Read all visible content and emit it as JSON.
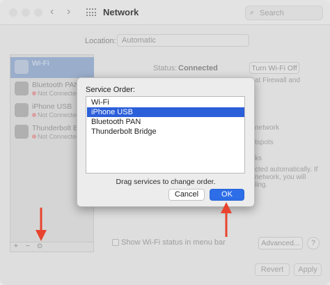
{
  "window": {
    "title": "Network",
    "search_placeholder": "Search"
  },
  "background": {
    "location_label": "Location:",
    "location_value": "Automatic",
    "status_label": "Status:",
    "status_value": "Connected",
    "turn_off_label": "Turn Wi-Fi Off",
    "fragments": [
      "at Firewall and",
      "network",
      "tspots",
      "ks",
      "cted automatically. If",
      "network, you will",
      "ling."
    ],
    "wifi_status_label": "Show Wi-Fi status in menu bar",
    "advanced_label": "Advanced...",
    "help_label": "?",
    "revert_label": "Revert",
    "apply_label": "Apply"
  },
  "sidebar": {
    "items": [
      {
        "name": "Wi-Fi",
        "status": ""
      },
      {
        "name": "Bluetooth PAN",
        "status": "Not Connected"
      },
      {
        "name": "iPhone USB",
        "status": "Not Connected"
      },
      {
        "name": "Thunderbolt Bridge",
        "status": "Not Connected"
      }
    ],
    "add_label": "+",
    "remove_label": "−",
    "action_label": "⊙"
  },
  "dialog": {
    "title": "Service Order:",
    "services": [
      "Wi-Fi",
      "iPhone USB",
      "Bluetooth PAN",
      "Thunderbolt Bridge"
    ],
    "selected_index": 1,
    "hint": "Drag services to change order.",
    "cancel_label": "Cancel",
    "ok_label": "OK"
  },
  "colors": {
    "accent": "#2d6ee8",
    "selection": "#2b5fd9",
    "annotation_arrow": "#e8432e"
  }
}
